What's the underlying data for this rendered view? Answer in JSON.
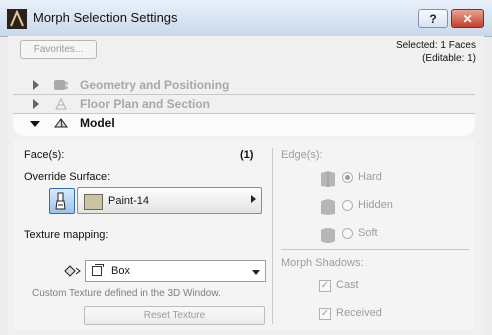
{
  "window": {
    "title": "Morph Selection Settings",
    "help_label": "?",
    "close_label": "✕"
  },
  "toolbar": {
    "favorites_label": "Favorites...",
    "selected_text": "Selected: 1 Faces",
    "editable_text": "(Editable: 1)"
  },
  "sections": [
    {
      "label": "Geometry and Positioning",
      "icon": "geometry-icon",
      "expanded": false
    },
    {
      "label": "Floor Plan and Section",
      "icon": "floor-plan-icon",
      "expanded": false
    },
    {
      "label": "Model",
      "icon": "model-icon",
      "expanded": true
    }
  ],
  "model": {
    "faces_label": "Face(s):",
    "faces_count": "(1)",
    "override_surface_label": "Override Surface:",
    "surface_value": "Paint-14",
    "surface_color": "#cdc3a0",
    "texture_mapping_label": "Texture mapping:",
    "mapping_value": "Box",
    "custom_texture_note": "Custom Texture defined in the 3D Window.",
    "reset_texture_label": "Reset Texture",
    "edges_label": "Edge(s):",
    "edge_options": [
      {
        "label": "Hard",
        "checked": true
      },
      {
        "label": "Hidden",
        "checked": false
      },
      {
        "label": "Soft",
        "checked": false
      }
    ],
    "shadows_label": "Morph Shadows:",
    "shadow_options": [
      {
        "label": "Cast",
        "checked": true
      },
      {
        "label": "Received",
        "checked": true
      }
    ]
  }
}
